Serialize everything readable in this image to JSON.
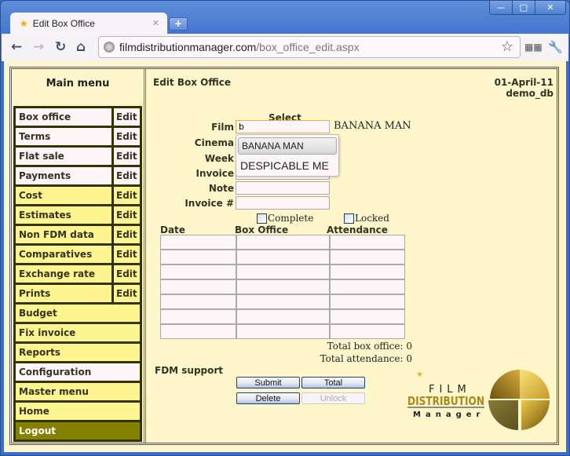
{
  "browser": {
    "tab_title": "Edit Box Office",
    "tab_icon": "star-favicon",
    "url_domain": "filmdistributionmanager.com",
    "url_path": "/box_office_edit.aspx",
    "window_controls": [
      "minimize",
      "maximize",
      "close"
    ]
  },
  "menu": {
    "title": "Main menu",
    "items": [
      {
        "label": "Box office",
        "edit": "Edit",
        "style": "white"
      },
      {
        "label": "Terms",
        "edit": "Edit",
        "style": "white"
      },
      {
        "label": "Flat sale",
        "edit": "Edit",
        "style": "white"
      },
      {
        "label": "Payments",
        "edit": "Edit",
        "style": "white"
      },
      {
        "label": "Cost",
        "edit": "Edit",
        "style": "yellow"
      },
      {
        "label": "Estimates",
        "edit": "Edit",
        "style": "yellow"
      },
      {
        "label": "Non FDM data",
        "edit": "Edit",
        "style": "yellow"
      },
      {
        "label": "Comparatives",
        "edit": "Edit",
        "style": "yellow"
      },
      {
        "label": "Exchange rate",
        "edit": "Edit",
        "style": "yellow"
      },
      {
        "label": "Prints",
        "edit": "Edit",
        "style": "yellow"
      },
      {
        "label": "Budget",
        "style": "yellow"
      },
      {
        "label": "Fix invoice",
        "style": "yellow"
      },
      {
        "label": "Reports",
        "style": "yellow"
      },
      {
        "label": "Configuration",
        "style": "white"
      },
      {
        "label": "Master menu",
        "style": "yellow"
      },
      {
        "label": "Home",
        "style": "yellow"
      },
      {
        "label": "Logout",
        "style": "logout"
      }
    ]
  },
  "content": {
    "title": "Edit Box Office",
    "date": "01-April-11",
    "db": "demo_db",
    "select_heading": "Select",
    "fields": {
      "film_label": "Film",
      "film_value": "b",
      "film_selected": "BANANA MAN",
      "cinema_label": "Cinema",
      "week_label": "Week",
      "invoice_label": "Invoice",
      "note_label": "Note",
      "invoice_no_label": "Invoice #"
    },
    "autocomplete": [
      "BANANA MAN",
      "DESPICABLE ME"
    ],
    "complete_label": "Complete",
    "locked_label": "Locked",
    "columns": [
      "Date",
      "Box Office",
      "Attendance"
    ],
    "row_count": 7,
    "total_box_office": "Total box office: 0",
    "total_attendance": "Total attendance: 0",
    "support": "FDM support",
    "buttons": {
      "submit": "Submit",
      "total": "Total",
      "delete": "Delete",
      "unlock": "Unlock"
    },
    "logo": {
      "line1": "FILM",
      "line2": "DISTRIBUTION",
      "line3": "Manager"
    }
  }
}
